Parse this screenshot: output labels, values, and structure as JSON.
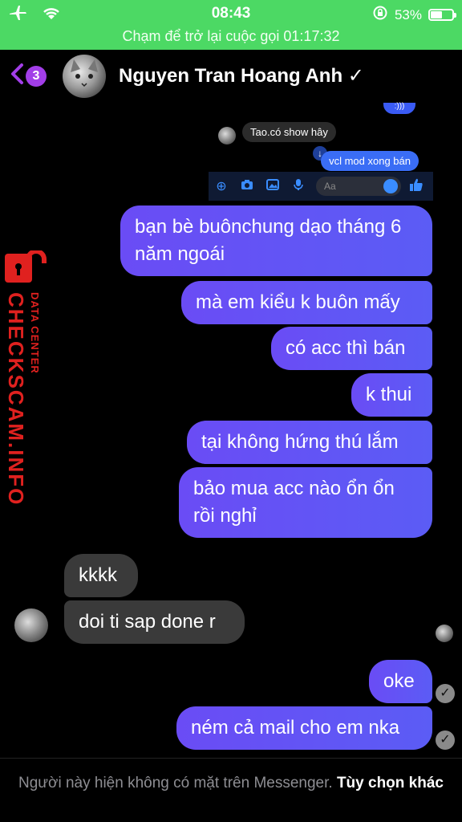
{
  "status_bar": {
    "time": "08:43",
    "battery_percent": "53%",
    "battery_level": 0.53,
    "icons": [
      "airplane-icon",
      "wifi-icon",
      "orientation-lock-icon",
      "battery-icon"
    ]
  },
  "call_banner": {
    "text": "Chạm để trở lại cuộc gọi 01:17:32"
  },
  "header": {
    "back_badge": "3",
    "contact_name": "Nguyen Tran Hoang Anh",
    "name_suffix": "✓"
  },
  "embedded_screenshot": {
    "top_fragment": ":)))",
    "incoming_text": "Tao.có show hây",
    "outgoing_text": "vcl mod xong bán",
    "input_placeholder": "Aa"
  },
  "messages": {
    "out_1": "bạn bè buônchung dạo tháng 6 năm ngoái",
    "out_2": "mà em kiểu k buôn mấy",
    "out_3": "có acc thì bán",
    "out_4": "k thui",
    "out_5": "tại không hứng thú lắm",
    "out_6": "bảo mua acc nào ổn ổn rồi nghỉ",
    "in_1": "kkkk",
    "in_2": "doi ti sap done r",
    "out_7": "oke",
    "out_8": "ném cả mail cho em nka"
  },
  "watermark": {
    "brand": "CHECKSCAM.INFO",
    "sub": "DATA CENTER"
  },
  "footer": {
    "status_text": "Người này hiện không có mặt trên Messenger.",
    "link_text": "Tùy chọn khác"
  },
  "colors": {
    "status_green": "#4cd964",
    "accent_purple": "#a23ee8",
    "bubble_outgoing": "#6a4cf5",
    "bubble_incoming": "#3a3a3a",
    "watermark_red": "#e0211f"
  }
}
